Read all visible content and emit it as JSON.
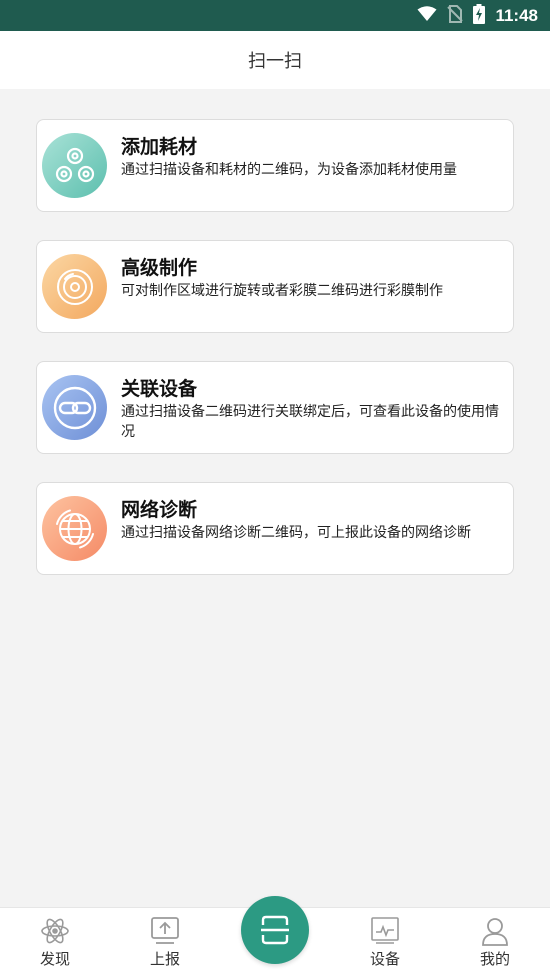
{
  "status_bar": {
    "time": "11:48"
  },
  "header": {
    "title": "扫一扫"
  },
  "cards": [
    {
      "title": "添加耗材",
      "description": "通过扫描设备和耗材的二维码，为设备添加耗材使用量",
      "icon": "consumables-icon",
      "color_from": "#a9e2d7",
      "color_to": "#5cbfae"
    },
    {
      "title": "高级制作",
      "description": "可对制作区域进行旋转或者彩膜二维码进行彩膜制作",
      "icon": "disc-icon",
      "color_from": "#fbd7a4",
      "color_to": "#f3a85f"
    },
    {
      "title": "关联设备",
      "description": "通过扫描设备二维码进行关联绑定后，可查看此设备的使用情况",
      "icon": "link-icon",
      "color_from": "#a9c4f2",
      "color_to": "#6e8fd6"
    },
    {
      "title": "网络诊断",
      "description": "通过扫描设备网络诊断二维码，可上报此设备的网络诊断",
      "icon": "globe-icon",
      "color_from": "#fdc3a0",
      "color_to": "#f58a66"
    }
  ],
  "tabbar": {
    "items": [
      {
        "label": "发现",
        "icon": "atom-icon"
      },
      {
        "label": "上报",
        "icon": "upload-icon"
      },
      {
        "label": "",
        "icon": "scan-icon"
      },
      {
        "label": "设备",
        "icon": "monitor-icon"
      },
      {
        "label": "我的",
        "icon": "person-icon"
      }
    ],
    "accent": "#2c9a83"
  }
}
